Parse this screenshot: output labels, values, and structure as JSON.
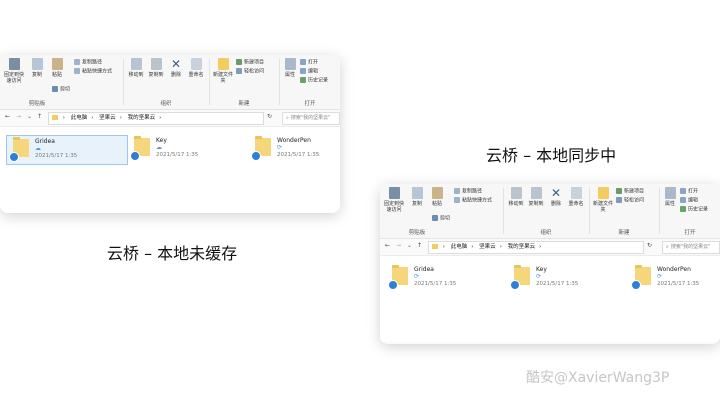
{
  "ribbon": {
    "pin_label": "固定到快速访问",
    "copy_label": "复制",
    "paste_label": "粘贴",
    "copy_path_label": "复制路径",
    "paste_shortcut_label": "粘贴快捷方式",
    "cut_label": "剪切",
    "clipboard_group": "剪贴板",
    "move_to_label": "移动到",
    "copy_to_label": "复制到",
    "delete_label": "删除",
    "rename_label": "重命名",
    "organize_group": "组织",
    "new_folder_label": "新建文件夹",
    "new_item_label": "新建项目",
    "easy_access_label": "轻松访问",
    "new_group": "新建",
    "properties_label": "属性",
    "open_label": "打开",
    "edit_label": "编辑",
    "history_label": "历史记录",
    "open_group": "打开"
  },
  "address": {
    "back": "←",
    "forward": "→",
    "down": "⌄",
    "up": "↑",
    "crumbs": [
      "此电脑",
      "坚果云",
      "我的坚果云"
    ],
    "search_placeholder": "搜索\"我的坚果云\""
  },
  "files": [
    {
      "name": "Gridea",
      "date": "2021/5/17 1:35"
    },
    {
      "name": "Key",
      "date": "2021/5/17 1:35"
    },
    {
      "name": "WonderPen",
      "date": "2021/5/17 1:35"
    }
  ],
  "status_icons": {
    "cloud": "☁",
    "sync": "⟳"
  },
  "captions": {
    "local_not_cached": "云桥 – 本地未缓存",
    "local_syncing": "云桥 – 本地同步中"
  },
  "watermark": "酷安@XavierWang3P"
}
